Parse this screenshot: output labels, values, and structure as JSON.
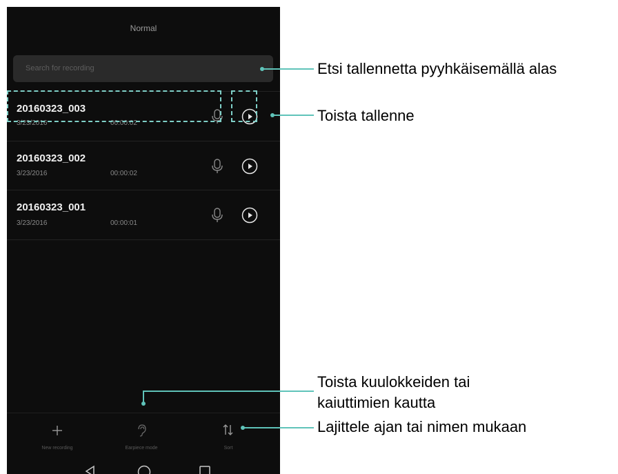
{
  "screen": {
    "title": "Normal",
    "search_placeholder": "Search for recording"
  },
  "recordings": [
    {
      "name": "20160323_003",
      "date": "3/23/2016",
      "duration": "00:00:02"
    },
    {
      "name": "20160323_002",
      "date": "3/23/2016",
      "duration": "00:00:02"
    },
    {
      "name": "20160323_001",
      "date": "3/23/2016",
      "duration": "00:00:01"
    }
  ],
  "toolbar": {
    "new_label": "New recording",
    "earpiece_label": "Earpiece mode",
    "sort_label": "Sort"
  },
  "callouts": {
    "search": "Etsi tallennetta pyyhkäisemällä alas",
    "play": "Toista tallenne",
    "earpiece_line1": "Toista kuulokkeiden tai",
    "earpiece_line2": "kaiuttimien kautta",
    "sort": "Lajittele ajan tai nimen mukaan"
  },
  "colors": {
    "phone_bg": "#0d0d0d",
    "callout_line": "#5fc3b9",
    "highlight_border": "#7fd0c8"
  },
  "icons": [
    "microphone-icon",
    "play-icon",
    "plus-icon",
    "ear-icon",
    "sort-icon",
    "back-icon",
    "home-icon",
    "recents-icon"
  ]
}
